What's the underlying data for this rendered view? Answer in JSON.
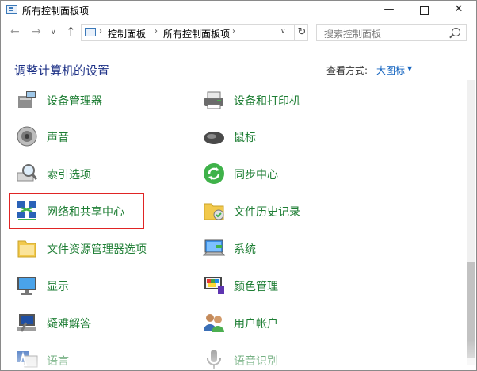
{
  "window": {
    "title": "所有控制面板项",
    "controls": {
      "minimize": "—",
      "close": "✕"
    }
  },
  "nav": {
    "back": "←",
    "forward": "→",
    "recent": "∨",
    "up": "↑",
    "breadcrumb": [
      "控制面板",
      "所有控制面板项"
    ],
    "separator": "›",
    "dropdown": "∨",
    "refresh": "↻"
  },
  "search": {
    "placeholder": "搜索控制面板"
  },
  "content": {
    "title": "调整计算机的设置",
    "view_by_label": "查看方式:",
    "view_by_value": "大图标",
    "view_by_arrow": "▼"
  },
  "items": [
    {
      "label": "设备管理器",
      "icon": "device-manager-icon"
    },
    {
      "label": "设备和打印机",
      "icon": "printer-icon"
    },
    {
      "label": "声音",
      "icon": "speaker-icon"
    },
    {
      "label": "鼠标",
      "icon": "mouse-icon"
    },
    {
      "label": "索引选项",
      "icon": "index-options-icon"
    },
    {
      "label": "同步中心",
      "icon": "sync-icon"
    },
    {
      "label": "网络和共享中心",
      "icon": "network-icon",
      "highlighted": true
    },
    {
      "label": "文件历史记录",
      "icon": "file-history-icon"
    },
    {
      "label": "文件资源管理器选项",
      "icon": "folder-options-icon"
    },
    {
      "label": "系统",
      "icon": "system-icon"
    },
    {
      "label": "显示",
      "icon": "display-icon"
    },
    {
      "label": "颜色管理",
      "icon": "color-management-icon"
    },
    {
      "label": "疑难解答",
      "icon": "troubleshooting-icon"
    },
    {
      "label": "用户帐户",
      "icon": "user-accounts-icon"
    },
    {
      "label": "语言",
      "icon": "language-icon"
    },
    {
      "label": "语音识别",
      "icon": "microphone-icon"
    }
  ],
  "colors": {
    "link_green": "#1e7e34",
    "title_blue": "#1e3287",
    "accent_blue": "#1565c0",
    "highlight_red": "#e02424"
  }
}
